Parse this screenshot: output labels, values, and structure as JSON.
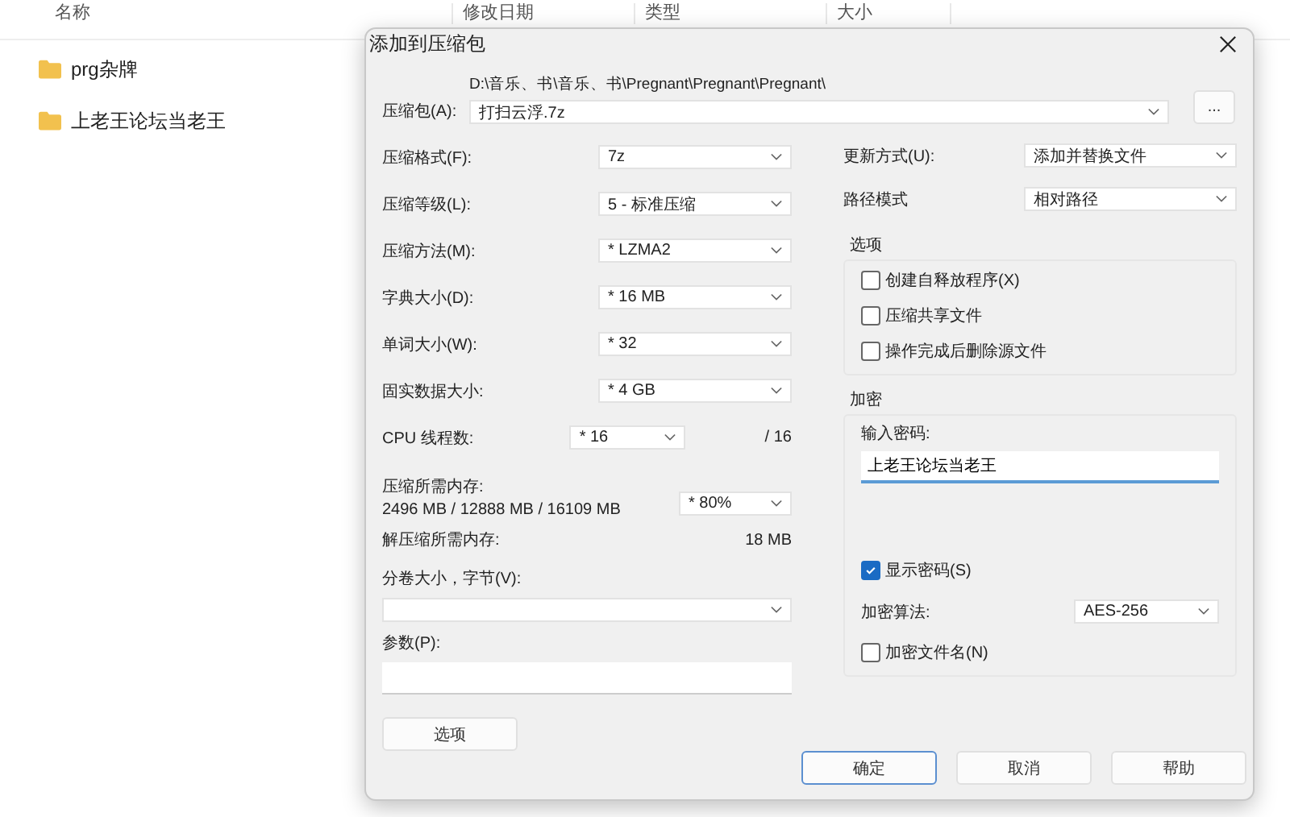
{
  "explorer": {
    "columns": [
      {
        "label": "名称"
      },
      {
        "label": "修改日期"
      },
      {
        "label": "类型"
      },
      {
        "label": "大小"
      }
    ],
    "items": [
      {
        "name": "prg杂牌"
      },
      {
        "name": "上老王论坛当老王"
      }
    ]
  },
  "dialog": {
    "title": "添加到压缩包",
    "archive": {
      "label": "压缩包(A):",
      "path": "D:\\音乐、书\\音乐、书\\Pregnant\\Pregnant\\Pregnant\\",
      "value": "打扫云浮.7z",
      "browse": "..."
    },
    "left_rows": [
      {
        "kind": "select",
        "label": "压缩格式(F):",
        "value": "7z"
      },
      {
        "kind": "select",
        "label": "压缩等级(L):",
        "value": "5 - 标准压缩"
      },
      {
        "kind": "select",
        "label": "压缩方法(M):",
        "value": "*  LZMA2"
      },
      {
        "kind": "select",
        "label": "字典大小(D):",
        "value": "*  16 MB"
      },
      {
        "kind": "select",
        "label": "单词大小(W):",
        "value": "*  32"
      },
      {
        "kind": "select",
        "label": "固实数据大小:",
        "value": "*  4 GB"
      },
      {
        "kind": "threads",
        "label": "CPU 线程数:",
        "value": "*  16",
        "suffix": "/ 16"
      },
      {
        "kind": "memory",
        "label": "压缩所需内存:",
        "detail": "2496 MB / 12888 MB / 16109 MB",
        "value": "*  80%"
      },
      {
        "kind": "text",
        "label": "解压缩所需内存:",
        "value": "18 MB"
      },
      {
        "kind": "wide_select",
        "label": "分卷大小，字节(V):",
        "value": ""
      },
      {
        "kind": "input",
        "label": "参数(P):",
        "value": ""
      }
    ],
    "options_button": "选项",
    "right_rows": [
      {
        "label": "更新方式(U):",
        "value": "添加并替换文件"
      },
      {
        "label": "路径模式",
        "value": "相对路径"
      }
    ],
    "options_group": {
      "title": "选项",
      "checkboxes": [
        {
          "label": "创建自释放程序(X)",
          "checked": false
        },
        {
          "label": "压缩共享文件",
          "checked": false
        },
        {
          "label": "操作完成后删除源文件",
          "checked": false
        }
      ]
    },
    "encryption": {
      "title": "加密",
      "password_label": "输入密码:",
      "password": "上老王论坛当老王",
      "show_password": {
        "label": "显示密码(S)",
        "checked": true
      },
      "method_label": "加密算法:",
      "method": "AES-256",
      "encrypt_names": {
        "label": "加密文件名(N)",
        "checked": false
      }
    },
    "buttons": [
      {
        "label": "确定",
        "default": true
      },
      {
        "label": "取消",
        "default": false
      },
      {
        "label": "帮助",
        "default": false
      }
    ]
  }
}
